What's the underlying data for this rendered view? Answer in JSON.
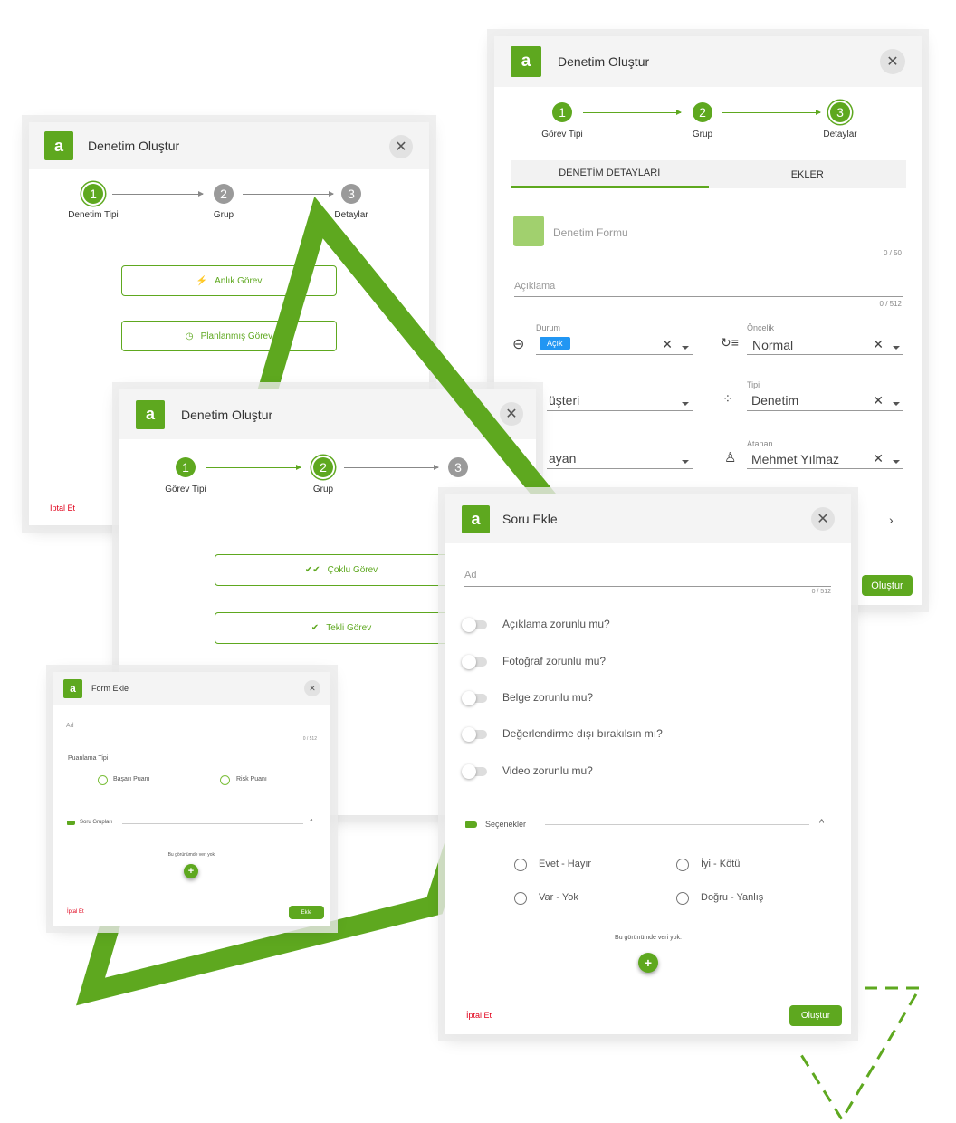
{
  "colors": {
    "brand": "#5ea81f",
    "danger": "#e0001a",
    "badge": "#2196f3"
  },
  "logo_letter": "a",
  "panel_a": {
    "title": "Denetim Oluştur",
    "steps": [
      "Denetim Tipi",
      "Grup",
      "Detaylar"
    ],
    "step_numbers": [
      "1",
      "2",
      "3"
    ],
    "options": [
      "Anlık Görev",
      "Planlanmış Görev"
    ],
    "cancel": "İptal Et"
  },
  "panel_b": {
    "title": "Denetim Oluştur",
    "steps": [
      "Görev Tipi",
      "Grup",
      "Detaylar"
    ],
    "step_numbers": [
      "1",
      "2",
      "3"
    ],
    "tabs": [
      "DENETİM DETAYLARI",
      "EKLER"
    ],
    "form_name_placeholder": "Denetim Formu",
    "form_name_count": "0 / 50",
    "desc_placeholder": "Açıklama",
    "desc_count": "0 / 512",
    "durum_label": "Durum",
    "durum_value": "Açık",
    "oncelik_label": "Öncelik",
    "oncelik_value": "Normal",
    "musteri_value": "üşteri",
    "tipi_label": "Tipi",
    "tipi_value": "Denetim",
    "sorumlu_value": "ayan",
    "atanan_label": "Atanan",
    "atanan_value": "Mehmet Yılmaz",
    "create": "Oluştur"
  },
  "panel_c": {
    "title": "Denetim Oluştur",
    "steps": [
      "Görev Tipi",
      "Grup"
    ],
    "step_numbers": [
      "1",
      "2",
      "3"
    ],
    "options": [
      "Çoklu Görev",
      "Tekli Görev"
    ]
  },
  "panel_e": {
    "title": "Form Ekle",
    "name_placeholder": "Ad",
    "name_count": "0 / 512",
    "scoring_label": "Puanlama Tipi",
    "scoring_options": [
      "Başarı Puanı",
      "Risk Puanı"
    ],
    "section": "Soru Grupları",
    "empty": "Bu görünümde veri yok.",
    "cancel": "İptal Et",
    "add": "Ekle"
  },
  "panel_d": {
    "title": "Soru Ekle",
    "name_placeholder": "Ad",
    "name_count": "0 / 512",
    "toggles": [
      "Açıklama zorunlu mu?",
      "Fotoğraf zorunlu mu?",
      "Belge zorunlu mu?",
      "Değerlendirme dışı bırakılsın mı?",
      "Video zorunlu mu?"
    ],
    "section": "Seçenekler",
    "options": [
      "Evet - Hayır",
      "İyi - Kötü",
      "Var - Yok",
      "Doğru - Yanlış"
    ],
    "empty": "Bu görünümde veri yok.",
    "cancel": "İptal Et",
    "create": "Oluştur"
  }
}
